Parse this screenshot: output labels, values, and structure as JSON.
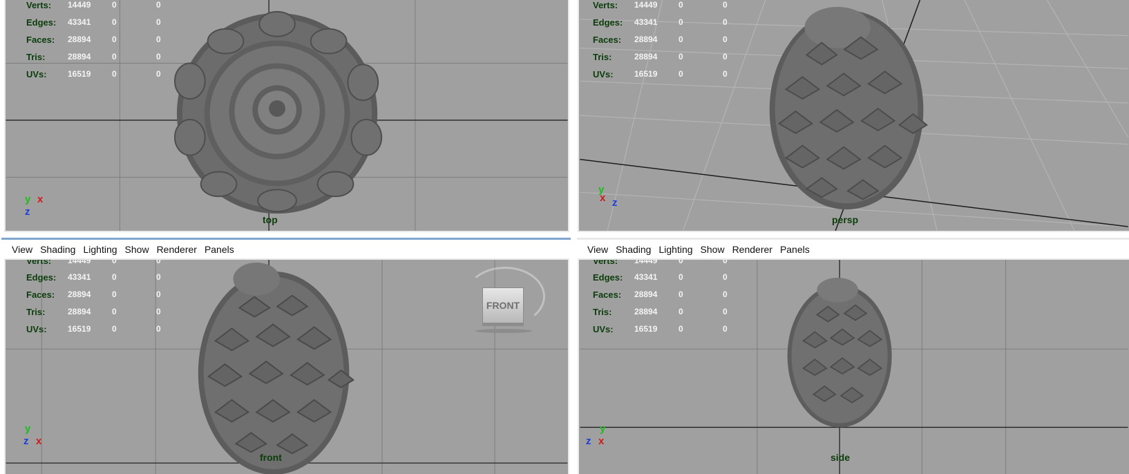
{
  "menu": [
    "View",
    "Shading",
    "Lighting",
    "Show",
    "Renderer",
    "Panels"
  ],
  "hud_rows": [
    {
      "label": "Verts:",
      "values": [
        "14449",
        "0",
        "0"
      ]
    },
    {
      "label": "Edges:",
      "values": [
        "43341",
        "0",
        "0"
      ]
    },
    {
      "label": "Faces:",
      "values": [
        "28894",
        "0",
        "0"
      ]
    },
    {
      "label": "Tris:",
      "values": [
        "28894",
        "0",
        "0"
      ]
    },
    {
      "label": "UVs:",
      "values": [
        "16519",
        "0",
        "0"
      ]
    }
  ],
  "panels": {
    "top": {
      "camera": "top",
      "axes": [
        "y",
        "x",
        "z"
      ]
    },
    "persp": {
      "camera": "persp",
      "axes": [
        "y",
        "x",
        "z"
      ]
    },
    "front": {
      "camera": "front",
      "axes": [
        "y",
        "z",
        "x"
      ],
      "viewcube": "FRONT"
    },
    "side": {
      "camera": "side",
      "axes": [
        "y",
        "z",
        "x"
      ]
    }
  },
  "colors": {
    "viewport_bg": "#a0a0a0",
    "hud_label": "#0b3d0b",
    "hud_value": "#f4f4f4",
    "axis_x": "#d21a1a",
    "axis_y": "#18c018",
    "axis_z": "#1e3ed8",
    "active_panel_border": "#7fa6cf",
    "model": "#6a6a6a"
  },
  "icons": [
    "axis-gizmo-icon",
    "view-cube-icon",
    "pinecone-model"
  ]
}
